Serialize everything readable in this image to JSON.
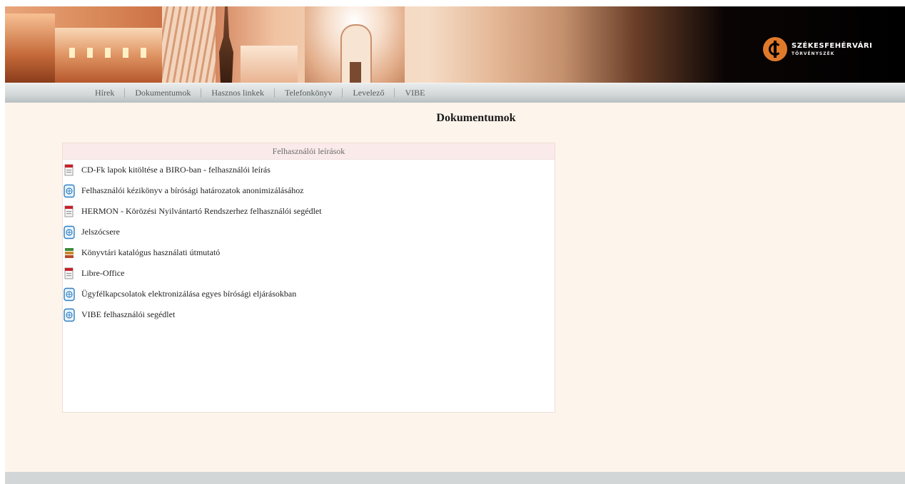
{
  "header": {
    "logo_line1": "SZÉKESFEHÉRVÁRI",
    "logo_line2": "TÖRVÉNYSZÉK"
  },
  "nav": {
    "items": [
      {
        "label": "Hírek"
      },
      {
        "label": "Dokumentumok"
      },
      {
        "label": "Hasznos linkek"
      },
      {
        "label": "Telefonkönyv"
      },
      {
        "label": "Levelező"
      },
      {
        "label": "VIBE"
      }
    ]
  },
  "main": {
    "title": "Dokumentumok",
    "panel": {
      "header": "Felhasználói leírások",
      "items": [
        {
          "label": "CD-Fk lapok kitöltése a BIRO-ban - felhasználói leírás",
          "icon": "pdf-icon"
        },
        {
          "label": "Felhasználói kézikönyv a bírósági határozatok anonimizálásához",
          "icon": "web-document-icon"
        },
        {
          "label": "HERMON - Körözési Nyilvántartó Rendszerhez felhasználói segédlet",
          "icon": "pdf-icon"
        },
        {
          "label": "Jelszócsere",
          "icon": "web-document-icon"
        },
        {
          "label": "Könyvtári katalógus használati útmutató",
          "icon": "archive-icon"
        },
        {
          "label": "Libre-Office",
          "icon": "pdf-icon"
        },
        {
          "label": "Ügyfélkapcsolatok elektronizálása egyes bírósági eljárásokban",
          "icon": "web-document-icon"
        },
        {
          "label": "VIBE felhasználói segédlet",
          "icon": "web-document-icon"
        }
      ]
    }
  },
  "colors": {
    "page_bg": "#fdf4ec",
    "panel_header_bg": "#fbeaea",
    "logo_accent": "#e07a2b",
    "nav_text": "#555a5c"
  }
}
